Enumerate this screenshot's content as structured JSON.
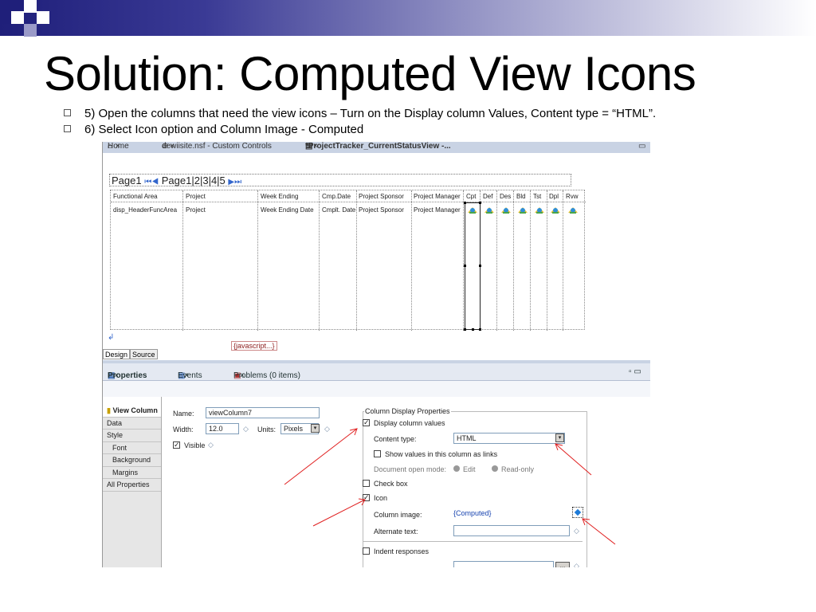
{
  "slide": {
    "title": "Solution: Computed View Icons",
    "bullets": [
      "5) Open the columns that need the view icons – Turn on the Display column Values, Content type = “HTML”.",
      "6) Select Icon option and Column Image - Computed"
    ]
  },
  "editor_tabs": [
    {
      "label": "Home"
    },
    {
      "label": "dewiisite.nsf - Custom Controls"
    },
    {
      "label": "*ProjectTracker_CurrentStatusView -..."
    }
  ],
  "pager": {
    "label1": "Page1",
    "label2": "Page1",
    "pages": "|2|3|4|5"
  },
  "view_columns": {
    "headers": [
      "Functional Area",
      "Project",
      "Week Ending",
      "Cmp.Date",
      "Project  Sponsor",
      "Project Manager",
      "Cpt",
      "Def",
      "Des",
      "Bld",
      "Tst",
      "Dpl",
      "Rvw"
    ],
    "values": [
      "disp_HeaderFuncArea",
      "Project",
      "Week Ending Date",
      "Cmplt. Date",
      "Project Sponsor",
      "Project Manager"
    ]
  },
  "javascript_tag": "{javascript...}",
  "bottom_tabs": {
    "design": "Design",
    "source": "Source"
  },
  "properties_tabs": {
    "properties": "Properties",
    "events": "Events",
    "problems": "Problems (0 items)"
  },
  "sidebar": {
    "items": [
      "View Column",
      "Data",
      "Style",
      "Font",
      "Background",
      "Margins",
      "All Properties"
    ]
  },
  "basic": {
    "name_label": "Name:",
    "name_value": "viewColumn7",
    "width_label": "Width:",
    "width_value": "12.0",
    "units_label": "Units:",
    "units_value": "Pixels",
    "visible_label": "Visible"
  },
  "column_display": {
    "group_title": "Column Display Properties",
    "display_values_label": "Display column values",
    "content_type_label": "Content type:",
    "content_type_value": "HTML",
    "show_links_label": "Show values in this column as links",
    "doc_open_mode_label": "Document open mode:",
    "edit_label": "Edit",
    "readonly_label": "Read-only",
    "checkbox_label": "Check box",
    "icon_label": "Icon",
    "column_image_label": "Column image:",
    "column_image_value": "{Computed}",
    "alternate_text_label": "Alternate text:",
    "indent_label": "Indent responses"
  }
}
